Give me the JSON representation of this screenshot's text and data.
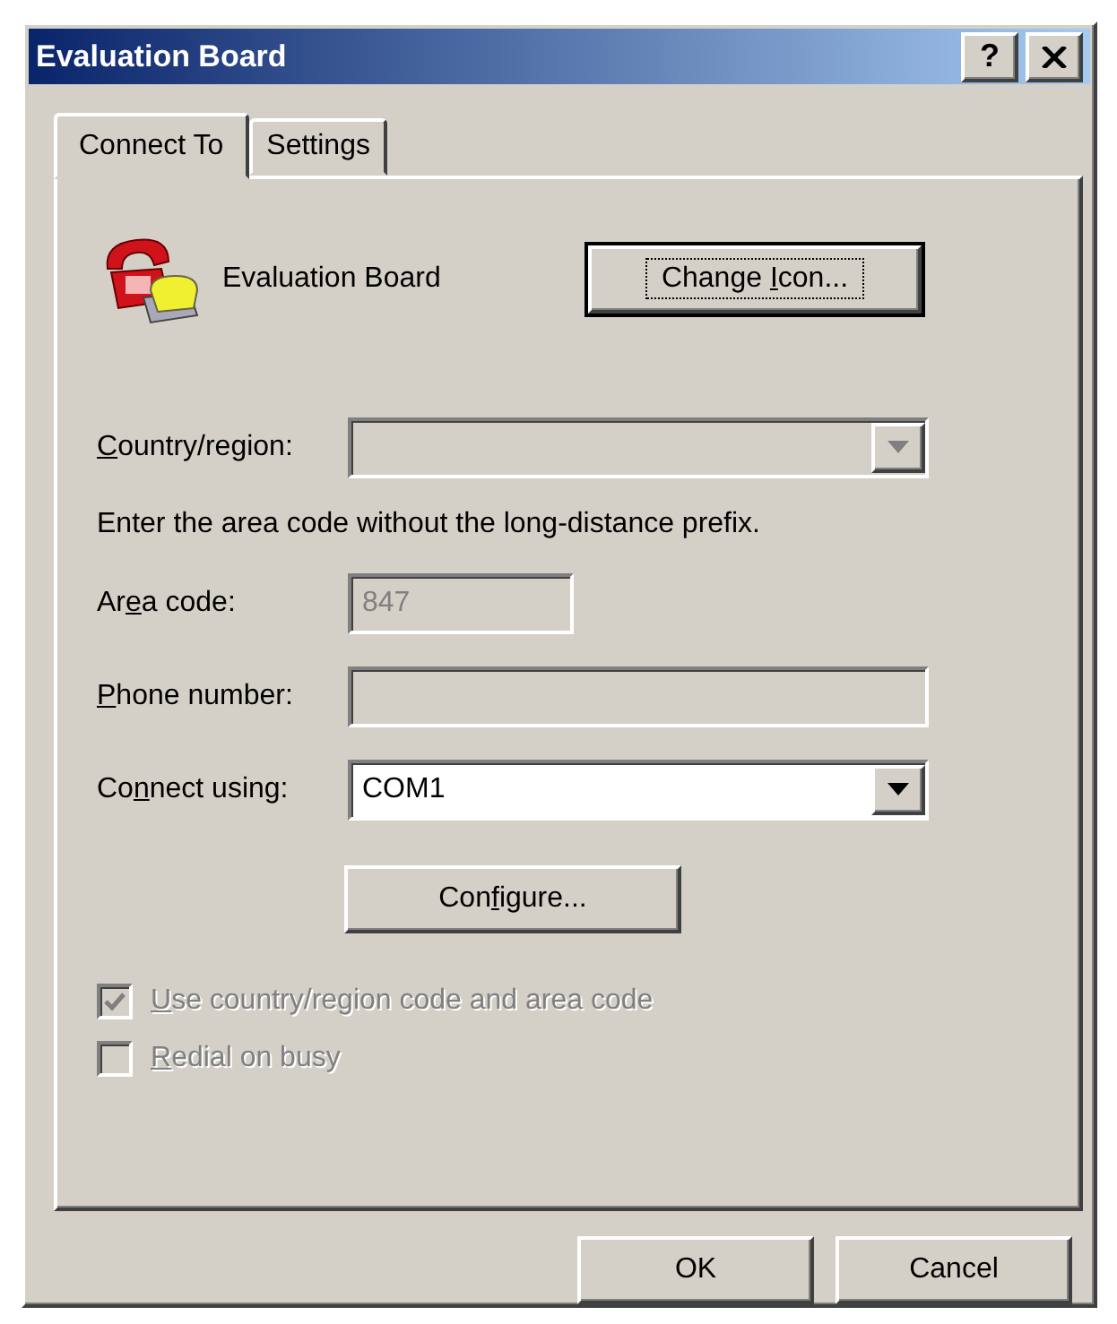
{
  "window": {
    "title": "Evaluation Board",
    "title_buttons": [
      {
        "kind": "help",
        "text": "?"
      },
      {
        "kind": "close"
      }
    ]
  },
  "tabs": [
    {
      "label": "Connect To",
      "selected": true
    },
    {
      "label": "Settings",
      "selected": false
    }
  ],
  "connection": {
    "name": "Evaluation Board",
    "change_icon_button": {
      "pre": "Change ",
      "key": "I",
      "post": "con..."
    }
  },
  "fields": [
    {
      "kind": "dropdown",
      "label": {
        "key": "C",
        "post": "ountry/region:"
      },
      "disabled": true
    },
    {
      "kind": "note",
      "text": "Enter the area code without the long-distance prefix."
    },
    {
      "kind": "short_text",
      "label": {
        "pre": "Ar",
        "key": "e",
        "post": "a code:"
      },
      "value": "847",
      "disabled": true
    },
    {
      "kind": "text",
      "label": {
        "key": "P",
        "post": "hone number:"
      },
      "disabled": true
    },
    {
      "kind": "dropdown",
      "label": {
        "pre": "Co",
        "key": "n",
        "post": "nect using:"
      },
      "value": "COM1",
      "disabled": false
    }
  ],
  "configure_button": {
    "pre": "Con",
    "key": "f",
    "post": "igure..."
  },
  "checkboxes": [
    {
      "label": {
        "key": "U",
        "post": "se country/region code and area code"
      },
      "checked": true,
      "disabled": true
    },
    {
      "label": {
        "key": "R",
        "post": "edial on busy"
      },
      "checked": false,
      "disabled": true
    }
  ],
  "buttons": [
    "OK",
    "Cancel"
  ]
}
